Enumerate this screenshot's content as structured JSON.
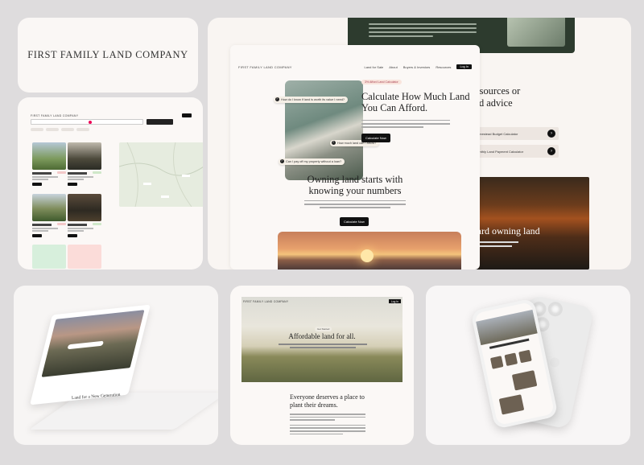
{
  "brand": {
    "name": "FIRST FAMILY LAND COMPANY"
  },
  "nav": {
    "items": [
      "Land for Sale",
      "About",
      "Buyers & Investors",
      "Resources"
    ],
    "login": "Log In"
  },
  "calculator": {
    "tag": "3% Afford Land Calculator",
    "headline": "Calculate How Much Land You Can Afford.",
    "cta": "Calculate Now",
    "bubbles": [
      "How do I know if land is worth its value I need?",
      "How much land can I afford?",
      "Can I pay off my property without a loan?"
    ]
  },
  "knowing": {
    "headline": "Owning land starts with knowing your numbers",
    "cta": "Calculate Now"
  },
  "resources": {
    "headline": "resources or\nzed advice",
    "buttons": [
      "Homestead Budget Calculator",
      "Monthly Land Payment Calculator"
    ]
  },
  "forest": {
    "headline": "ward owning land"
  },
  "laptop": {
    "tagline": "Land for a New Generation"
  },
  "affordable": {
    "pill": "Get Started",
    "headline": "Affordable land for all.",
    "subhead": "Everyone deserves a place to plant their dreams."
  },
  "colors": {
    "dark_green": "#2d3b2e",
    "accent": "#f9e4dc",
    "black": "#111111"
  }
}
